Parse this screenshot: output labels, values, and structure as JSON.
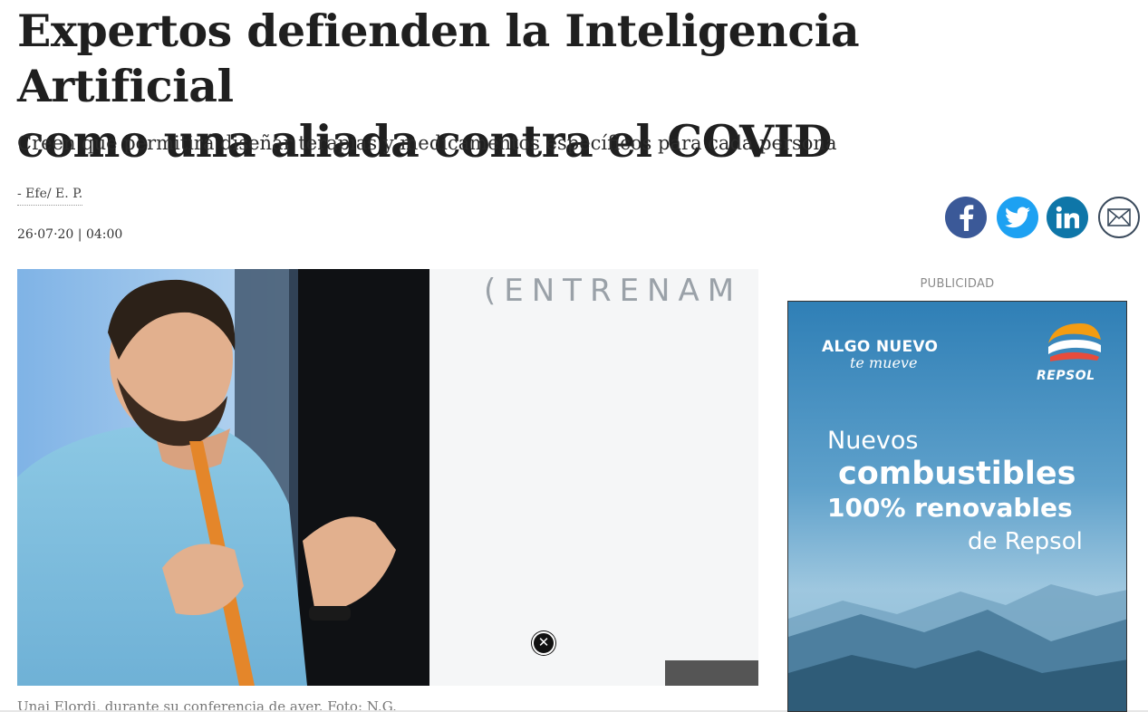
{
  "article": {
    "headline_line1": "Expertos defienden la Inteligencia Artificial",
    "headline_line2": "como una aliada contra el COVID",
    "subtitle": "Creen que permitirá diseñar terapias y medicamentos específicos para cada persona",
    "byline": "- Efe/ E. P.",
    "datetime": "26·07·20 | 04:00",
    "photo_backdrop_text": "(ENTRENAM",
    "caption": "Unai Elordi, durante su conferencia de ayer. Foto: N.G."
  },
  "share": {
    "icons": [
      "facebook-icon",
      "twitter-icon",
      "linkedin-icon",
      "mail-icon"
    ],
    "colors": {
      "facebook": "#3b5998",
      "twitter": "#1da1f2",
      "linkedin": "#0e76a8"
    }
  },
  "ad": {
    "label": "PUBLICIDAD",
    "tagline": "ALGO NUEVO",
    "tagline_script": "te mueve",
    "brand": "REPSOL",
    "line1": "Nuevos",
    "line2": "combustibles",
    "line3": "100% renovables",
    "line4": "de Repsol"
  },
  "overlay": {
    "close_glyph": "✕"
  }
}
